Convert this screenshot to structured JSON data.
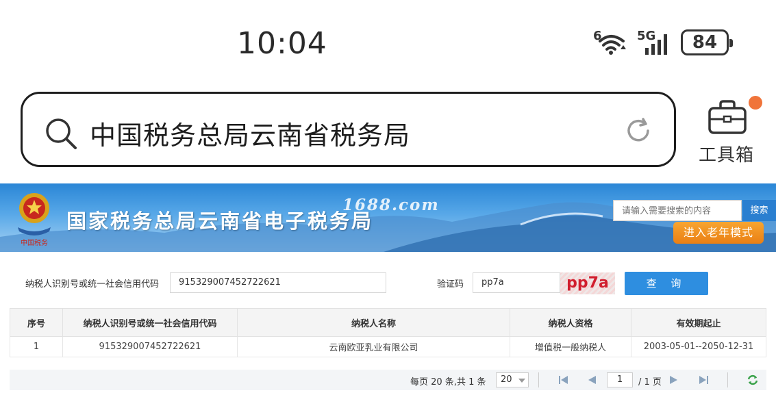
{
  "status_bar": {
    "time": "10:04",
    "wifi_label": "6",
    "network_label": "5G",
    "battery": "84"
  },
  "browser": {
    "search_text": "中国税务总局云南省税务局",
    "toolbox_label": "工具箱"
  },
  "site": {
    "title": "国家税务总局云南省电子税务局",
    "watermark": "1688.com",
    "search_placeholder": "请输入需要搜索的内容",
    "search_button": "搜索",
    "elder_mode_button": "进入老年模式"
  },
  "query_form": {
    "taxpayer_id_label": "纳税人识别号或统一社会信用代码",
    "taxpayer_id_value": "915329007452722621",
    "captcha_label": "验证码",
    "captcha_value": "pp7a",
    "captcha_image_text": "pp7a",
    "query_button": "查 询"
  },
  "results_table": {
    "headers": [
      "序号",
      "纳税人识别号或统一社会信用代码",
      "纳税人名称",
      "纳税人资格",
      "有效期起止"
    ],
    "rows": [
      [
        "1",
        "915329007452722621",
        "云南欧亚乳业有限公司",
        "增值税一般纳税人",
        "2003-05-01--2050-12-31"
      ]
    ]
  },
  "pager": {
    "summary": "每页 20 条,共 1 条",
    "page_size": "20",
    "current_page": "1",
    "total_pages": "/ 1 页"
  }
}
